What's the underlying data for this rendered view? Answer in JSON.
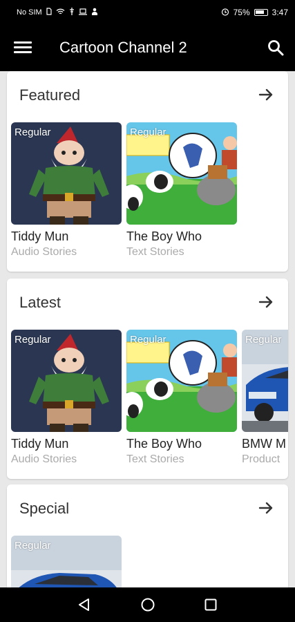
{
  "status_bar": {
    "carrier": "No SIM",
    "battery_percent": "75%",
    "time": "3:47"
  },
  "app_bar": {
    "menu_icon": "menu-icon",
    "title": "Cartoon Channel 2",
    "search_icon": "search-icon"
  },
  "sections": [
    {
      "title": "Featured",
      "arrow_icon": "arrow-right-icon",
      "items": [
        {
          "badge": "Regular",
          "title": "Tiddy Mun",
          "subtitle": "Audio Stories",
          "thumb": "gnome"
        },
        {
          "badge": "Regular",
          "title": "The Boy Who",
          "subtitle": "Text Stories",
          "thumb": "wolf"
        }
      ]
    },
    {
      "title": "Latest",
      "arrow_icon": "arrow-right-icon",
      "items": [
        {
          "badge": "Regular",
          "title": "Tiddy Mun",
          "subtitle": "Audio Stories",
          "thumb": "gnome"
        },
        {
          "badge": "Regular",
          "title": "The Boy Who",
          "subtitle": "Text Stories",
          "thumb": "wolf"
        },
        {
          "badge": "Regular",
          "title": "BMW M",
          "subtitle": "Product",
          "thumb": "car"
        }
      ]
    },
    {
      "title": "Special",
      "arrow_icon": "arrow-right-icon",
      "items": [
        {
          "badge": "Regular",
          "title": "",
          "subtitle": "",
          "thumb": "car"
        }
      ]
    }
  ],
  "nav_bar": {
    "back_icon": "back-triangle-icon",
    "home_icon": "home-circle-icon",
    "recents_icon": "recents-square-icon"
  },
  "colors": {
    "app_bar": "#000000",
    "background": "#e8e8e8",
    "card": "#ffffff",
    "subtitle": "#aaaaaa"
  }
}
